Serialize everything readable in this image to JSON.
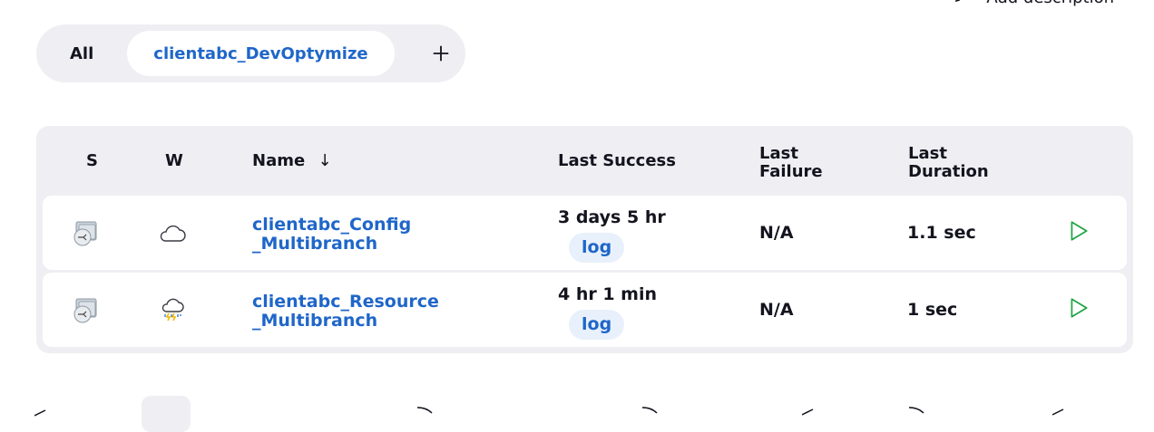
{
  "header": {
    "add_description_label": "Add description"
  },
  "tabs": [
    {
      "label": "All",
      "active": false
    },
    {
      "label": "clientabc_DevOptymize",
      "active": true
    }
  ],
  "table": {
    "columns": {
      "status": "S",
      "weather": "W",
      "name": "Name",
      "sort_arrow": "↓",
      "last_success": "Last Success",
      "last_failure_line1": "Last",
      "last_failure_line2": "Failure",
      "last_duration_line1": "Last",
      "last_duration_line2": "Duration"
    },
    "rows": [
      {
        "name_line1": "clientabc_Config",
        "name_line2": "_Multibranch",
        "weather": "cloudy-icon",
        "last_success": "3 days 5 hr",
        "log_label": "log",
        "last_failure": "N/A",
        "last_duration": "1.1 sec"
      },
      {
        "name_line1": "clientabc_Resource",
        "name_line2": "_Multibranch",
        "weather": "storm-icon",
        "last_success": "4 hr 1 min",
        "log_label": "log",
        "last_failure": "N/A",
        "last_duration": "1 sec"
      }
    ]
  },
  "colors": {
    "link": "#1f66c9",
    "run_green": "#1ea446",
    "panel": "#efeff3",
    "storm_blue": "#3a7bd5",
    "storm_yellow": "#f2b705"
  }
}
